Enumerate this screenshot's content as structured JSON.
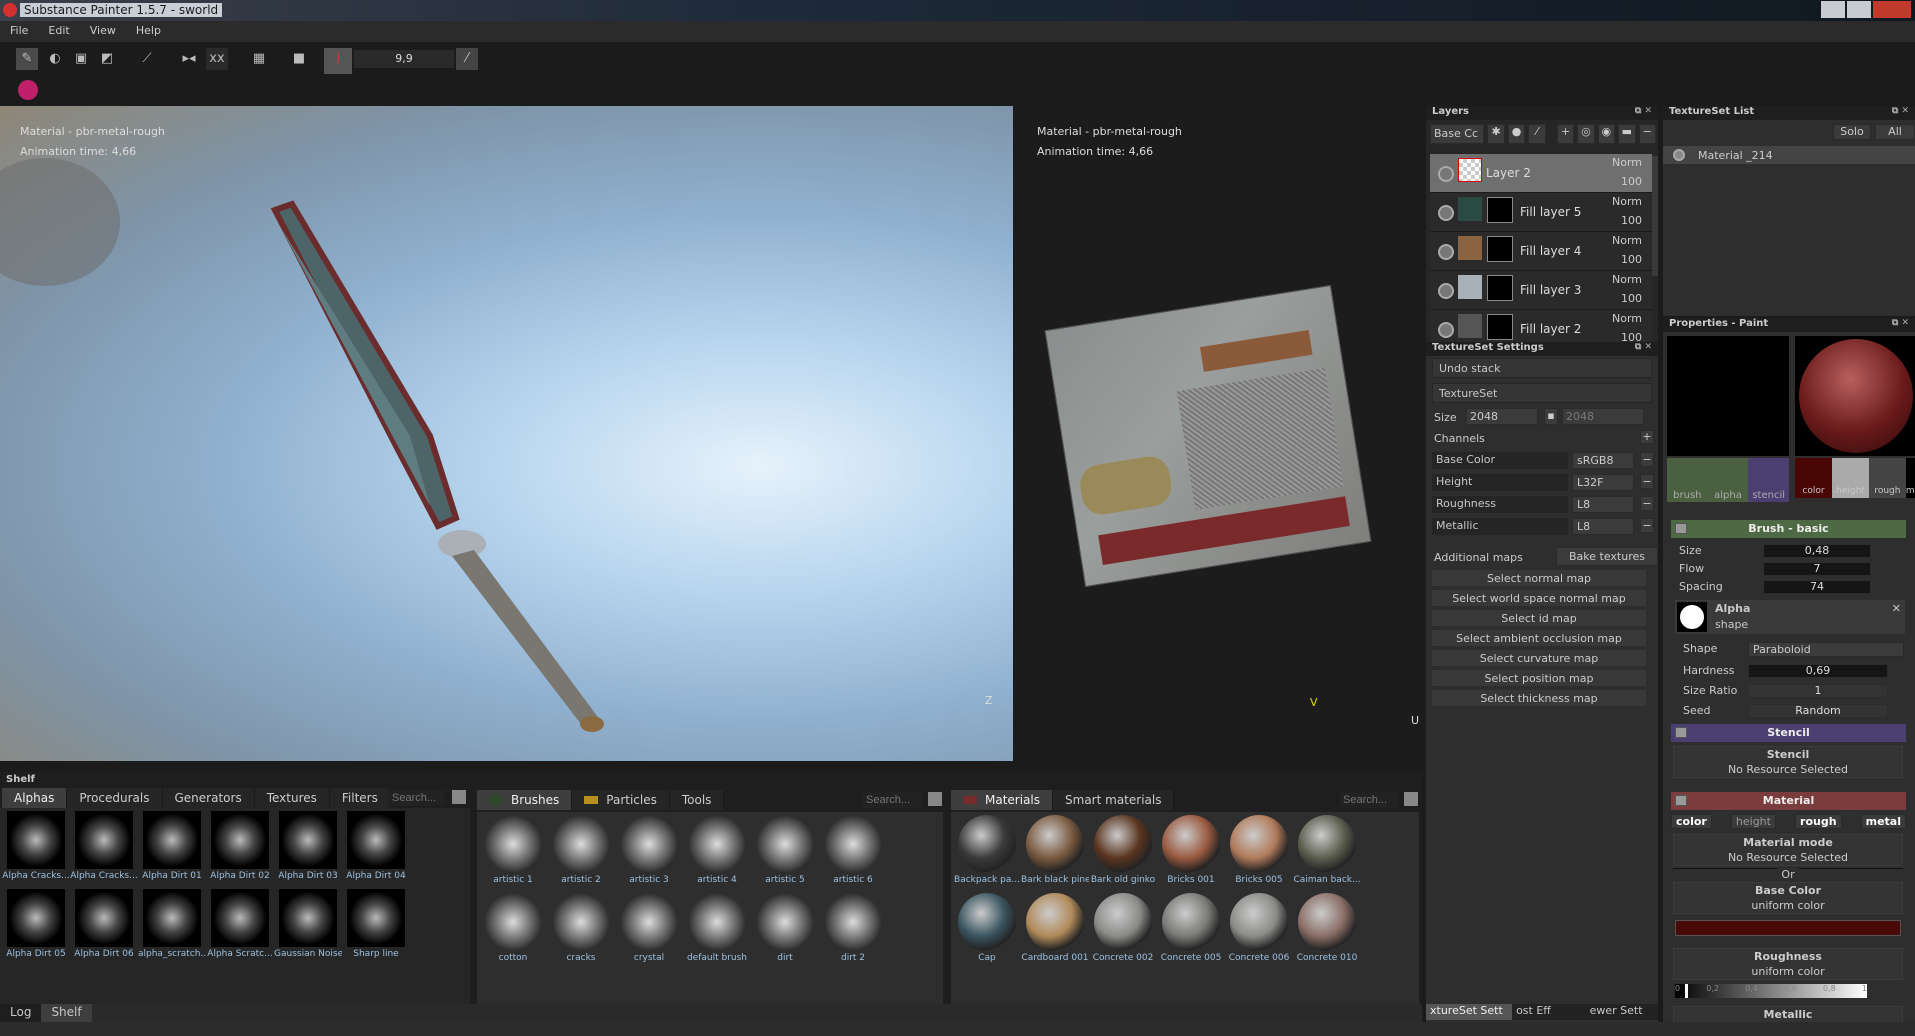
{
  "window": {
    "title": "Substance Painter 1.5.7 - sworld"
  },
  "menu": [
    "File",
    "Edit",
    "View",
    "Help"
  ],
  "toolbar": {
    "brush_size_value": "9,9"
  },
  "viewport3d": {
    "material": "Material - pbr-metal-rough",
    "animation_time": "Animation time: 4,66",
    "axis": "Z"
  },
  "viewport2d": {
    "material": "Material - pbr-metal-rough",
    "animation_time": "Animation time: 4,66",
    "axis_v": "V",
    "axis_u": "U"
  },
  "layers": {
    "title": "Layers",
    "channel_select": "Base Cc",
    "items": [
      {
        "name": "Layer 2",
        "blend": "Norm",
        "opacity": "100",
        "selected": true
      },
      {
        "name": "Fill layer 5",
        "blend": "Norm",
        "opacity": "100"
      },
      {
        "name": "Fill layer 4",
        "blend": "Norm",
        "opacity": "100"
      },
      {
        "name": "Fill layer 3",
        "blend": "Norm",
        "opacity": "100"
      },
      {
        "name": "Fill layer 2",
        "blend": "Norm",
        "opacity": "100"
      }
    ]
  },
  "textureset_list": {
    "title": "TextureSet List",
    "solo": "Solo",
    "all": "All",
    "items": [
      "Material _214"
    ]
  },
  "textureset_settings": {
    "title": "TextureSet Settings",
    "undo_stack": "Undo stack",
    "textureset": "TextureSet",
    "size_label": "Size",
    "size_w": "2048",
    "size_h": "2048",
    "channels_label": "Channels",
    "channels": [
      {
        "name": "Base Color",
        "format": "sRGB8"
      },
      {
        "name": "Height",
        "format": "L32F"
      },
      {
        "name": "Roughness",
        "format": "L8"
      },
      {
        "name": "Metallic",
        "format": "L8"
      }
    ],
    "additional_maps": "Additional maps",
    "bake": "Bake textures",
    "maps": [
      "Select normal map",
      "Select world space normal map",
      "Select id map",
      "Select ambient occlusion map",
      "Select curvature map",
      "Select position map",
      "Select thickness map"
    ],
    "bottom_tabs": [
      "xtureSet Sett",
      "ost Eff",
      "ewer Sett"
    ]
  },
  "properties": {
    "title": "Properties - Paint",
    "slots": [
      "brush",
      "alpha",
      "stencil"
    ],
    "mat_slots": [
      "color",
      "height",
      "rough",
      "m"
    ],
    "brush_section": "Brush - basic",
    "size_label": "Size",
    "size": "0,48",
    "flow_label": "Flow",
    "flow": "7",
    "spacing_label": "Spacing",
    "spacing": "74",
    "alpha_title": "Alpha",
    "alpha_sub": "shape",
    "shape_label": "Shape",
    "shape": "Paraboloid",
    "hardness_label": "Hardness",
    "hardness": "0,69",
    "ratio_label": "Size Ratio",
    "ratio": "1",
    "seed_label": "Seed",
    "seed": "Random",
    "stencil_section": "Stencil",
    "stencil_title": "Stencil",
    "stencil_none": "No Resource Selected",
    "material_section": "Material",
    "mat_toggles": [
      "color",
      "height",
      "rough",
      "metal"
    ],
    "mat_mode": "Material mode",
    "mat_none": "No Resource Selected",
    "or": "Or",
    "base_color": "Base Color",
    "base_color_sub": "uniform color",
    "base_color_hex": "#4a0a0a",
    "roughness": "Roughness",
    "roughness_sub": "uniform color",
    "rough_ticks": [
      "0",
      "0,2",
      "0,4",
      "0,6",
      "0,8",
      "1"
    ],
    "rough_value": 0.05,
    "metallic": "Metallic"
  },
  "shelf": {
    "title": "Shelf",
    "tabs": [
      "Alphas",
      "Procedurals",
      "Generators",
      "Textures",
      "Filters"
    ],
    "search": "Search...",
    "alphas": [
      "Alpha Cracks...",
      "Alpha Cracks...",
      "Alpha Dirt 01",
      "Alpha Dirt 02",
      "Alpha Dirt 03",
      "Alpha Dirt 04",
      "Alpha Dirt 05",
      "Alpha Dirt 06",
      "alpha_scratch...",
      "Alpha Scratc...",
      "Gaussian Noise",
      "Sharp line"
    ],
    "brush_tabs": [
      "Brushes",
      "Particles",
      "Tools"
    ],
    "brushes": [
      "artistic 1",
      "artistic 2",
      "artistic 3",
      "artistic 4",
      "artistic 5",
      "artistic 6",
      "cotton",
      "cracks",
      "crystal",
      "default brush",
      "dirt",
      "dirt 2"
    ],
    "material_tabs": [
      "Materials",
      "Smart materials"
    ],
    "materials": [
      "Backpack pa...",
      "Bark black pine",
      "Bark old ginko",
      "Bricks 001",
      "Bricks 005",
      "Caiman back...",
      "Cap",
      "Cardboard 001",
      "Concrete 002",
      "Concrete 005",
      "Concrete 006",
      "Concrete 010"
    ],
    "material_colors": [
      "#3a3a3a",
      "#7a5a40",
      "#5a3520",
      "#9a5a40",
      "#b07a5a",
      "#5a5e4e",
      "#3a5560",
      "#b08a5a",
      "#8a8a88",
      "#7a7a78",
      "#8a8c88",
      "#8a6e66"
    ],
    "bottom_tabs": [
      "Log",
      "Shelf"
    ]
  }
}
